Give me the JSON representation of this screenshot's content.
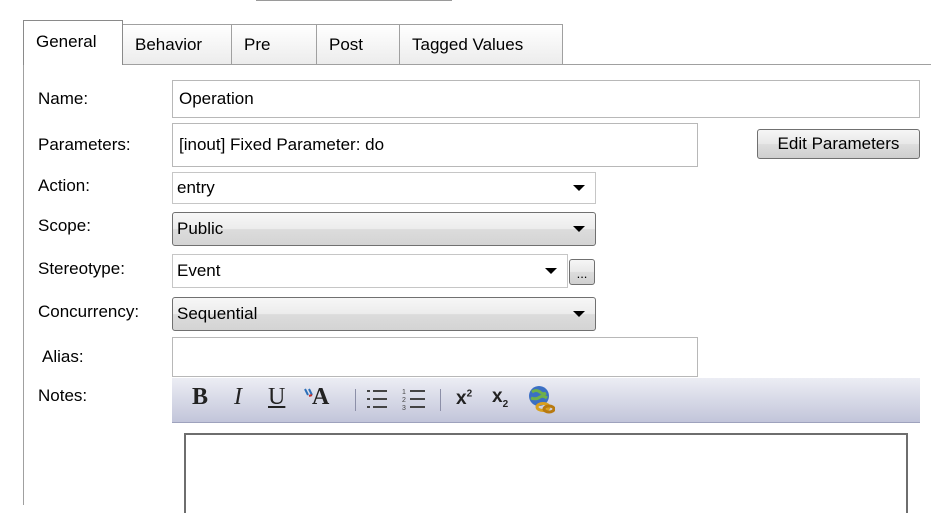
{
  "tabs": [
    {
      "label": "General",
      "active": true
    },
    {
      "label": "Behavior",
      "active": false
    },
    {
      "label": "Pre",
      "active": false
    },
    {
      "label": "Post",
      "active": false
    },
    {
      "label": "Tagged Values",
      "active": false
    }
  ],
  "form": {
    "name_label": "Name:",
    "name_value": "Operation",
    "parameters_label": "Parameters:",
    "parameters_value": "[inout] Fixed Parameter: do",
    "edit_parameters_button": "Edit Parameters",
    "action_label": "Action:",
    "action_value": "entry",
    "scope_label": "Scope:",
    "scope_value": "Public",
    "stereotype_label": "Stereotype:",
    "stereotype_value": "Event",
    "stereotype_browse": "...",
    "concurrency_label": "Concurrency:",
    "concurrency_value": "Sequential",
    "alias_label": "Alias:",
    "alias_value": "",
    "notes_label": "Notes:",
    "notes_value": ""
  },
  "toolbar": {
    "bold": "B",
    "italic": "I",
    "underline": "U",
    "font_color": "A",
    "superscript_base": "x",
    "superscript_mark": "2",
    "subscript_base": "x",
    "subscript_mark": "2",
    "icons": [
      "bold-icon",
      "italic-icon",
      "underline-icon",
      "font-color-icon",
      "bullet-list-icon",
      "numbered-list-icon",
      "superscript-icon",
      "subscript-icon",
      "hyperlink-icon"
    ]
  },
  "colors": {
    "toolbar_top": "#ecedf4",
    "toolbar_bottom": "#c2c5da"
  }
}
